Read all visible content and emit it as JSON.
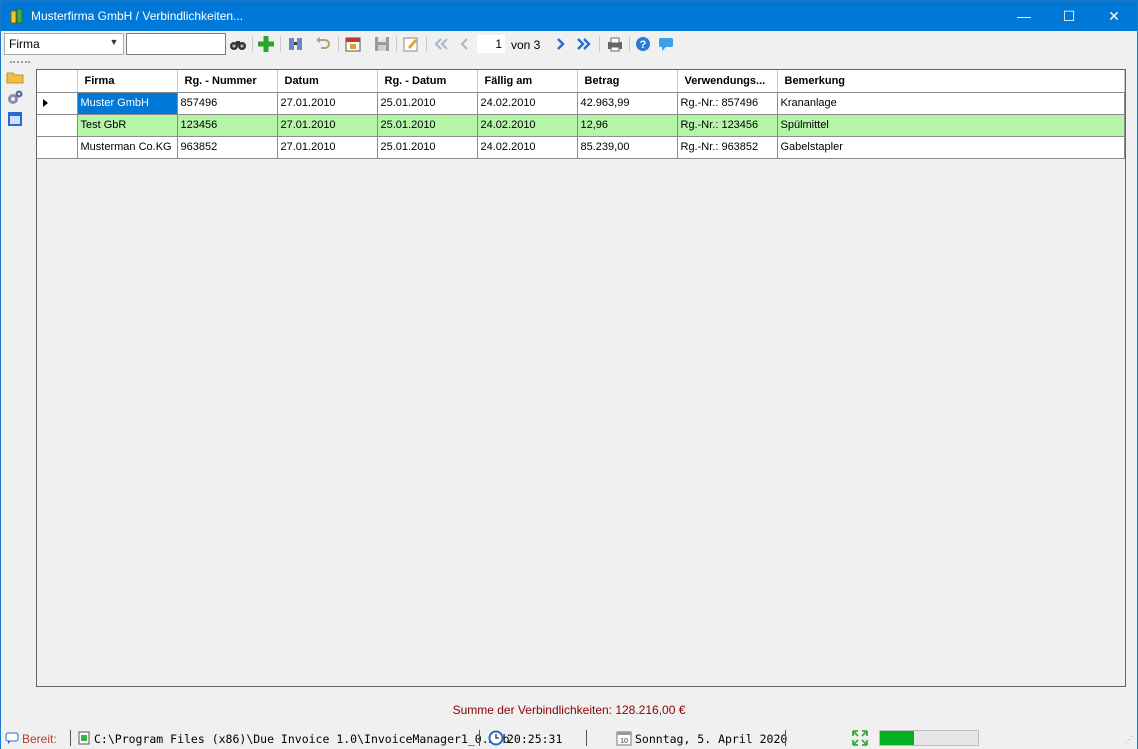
{
  "window": {
    "title": "Musterfirma GmbH / Verbindlichkeiten...",
    "controls": {
      "minimize": "—",
      "maximize": "☐",
      "close": "✕"
    }
  },
  "toolbar": {
    "filter_field": "Firma",
    "search_value": "",
    "page_current": "1",
    "page_of": "von 3",
    "icons": [
      "binoculars-icon",
      "add-icon",
      "find-icon",
      "undo-icon",
      "calendar-icon",
      "save-icon",
      "edit-icon",
      "first-page-icon",
      "prev-page-icon",
      "next-page-icon",
      "last-page-icon",
      "print-icon",
      "help-icon",
      "comment-icon"
    ]
  },
  "sidebar": {
    "icons": [
      "folder-icon",
      "settings-icon",
      "window-icon"
    ]
  },
  "grid": {
    "columns": [
      "Firma",
      "Rg. - Nummer",
      "Datum",
      "Rg. - Datum",
      "Fällig am",
      "Betrag",
      "Verwendungs...",
      "Bemerkung"
    ],
    "rows": [
      [
        "Muster GmbH",
        "857496",
        "27.01.2010",
        "25.01.2010",
        "24.02.2010",
        "42.963,99",
        "Rg.-Nr.: 857496",
        "Krananlage"
      ],
      [
        "Test GbR",
        "123456",
        "27.01.2010",
        "25.01.2010",
        "24.02.2010",
        "12,96",
        "Rg.-Nr.: 123456",
        "Spülmittel"
      ],
      [
        "Musterman Co.KG",
        "963852",
        "27.01.2010",
        "25.01.2010",
        "24.02.2010",
        "85.239,00",
        "Rg.-Nr.: 963852",
        "Gabelstapler"
      ]
    ],
    "highlight_color": "#b4f5a8",
    "selection_color": "#0078d7"
  },
  "summary": {
    "text": "Summe der Verbindlichkeiten: 128.216,00 €"
  },
  "statusbar": {
    "status": "Bereit:",
    "path": "C:\\Program Files (x86)\\Due Invoice 1.0\\InvoiceManager1_0.mdb",
    "time": "20:25:31",
    "date": "Sonntag, 5. April 2020",
    "progress": 0.35
  },
  "colors": {
    "titlebar": "#0078d7",
    "sum_text": "#8b0000",
    "progress": "#06b025"
  }
}
